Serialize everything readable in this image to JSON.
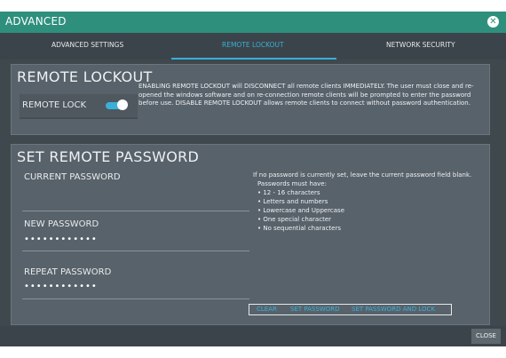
{
  "dialog": {
    "title": "ADVANCED",
    "tabs": [
      {
        "label": "ADVANCED SETTINGS"
      },
      {
        "label": "REMOTE LOCKOUT"
      },
      {
        "label": "NETWORK SECURITY"
      }
    ],
    "active_tab": "REMOTE LOCKOUT",
    "close_label": "CLOSE"
  },
  "remote_lockout": {
    "title": "REMOTE LOCKOUT",
    "toggle_label": "REMOTE LOCK",
    "toggle_state": "on",
    "warning_text": "ENABLING REMOTE LOCKOUT will DISCONNECT all remote clients IMMEDIATELY. The user must close and re-opened the windows software and on re-connection remote clients will be prompted to enter the password before use. DISABLE REMOTE LOCKOUT allows remote clients to connect without password authentication."
  },
  "set_password": {
    "title": "SET REMOTE PASSWORD",
    "fields": [
      {
        "label": "CURRENT PASSWORD",
        "value": ""
      },
      {
        "label": "NEW PASSWORD",
        "value": "••••••••••••"
      },
      {
        "label": "REPEAT PASSWORD",
        "value": "••••••••••••"
      }
    ],
    "help_intro": "If no password is currently set, leave the current password field blank.",
    "help_heading": "Passwords must have:",
    "rules": [
      "• 12 - 16 characters",
      "• Letters and numbers",
      "• Lowercase and Uppercase",
      "• One special character",
      "• No sequential characters"
    ],
    "actions": {
      "clear": "CLEAR",
      "set": "SET PASSWORD",
      "set_lock": "SET PASSWORD AND LOCK"
    }
  },
  "colors": {
    "accent": "#3ab0d8",
    "titlebar": "#2e8f7d",
    "panel": "#58626a",
    "background": "#3f484d"
  }
}
